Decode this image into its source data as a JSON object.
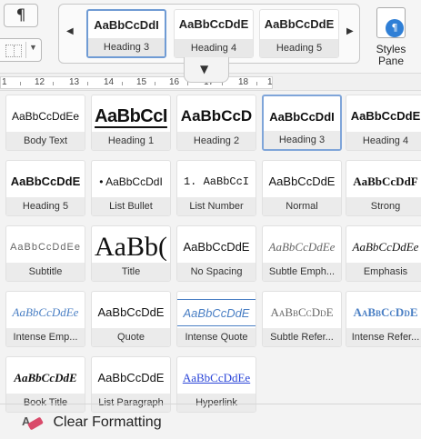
{
  "ribbon": {
    "pilcrow": "¶",
    "gallery": [
      {
        "sample": "AaBbCcDdI",
        "label": "Heading 3",
        "selected": true
      },
      {
        "sample": "AaBbCcDdE",
        "label": "Heading 4",
        "selected": false
      },
      {
        "sample": "AaBbCcDdE",
        "label": "Heading 5",
        "selected": false
      }
    ],
    "gallery_prev": "◀",
    "gallery_next": "▶",
    "styles_pane_label": "Styles Pane",
    "styles_pane_icon": "¶"
  },
  "ruler": {
    "numbers": [
      "1",
      "12",
      "13",
      "14",
      "15",
      "16",
      "17",
      "18",
      "1"
    ],
    "tab_marker": "▼"
  },
  "styles": [
    {
      "sample": "AaBbCcDdEe",
      "label": "Body Text",
      "cls": "st-bodytext"
    },
    {
      "sample": "AaBbCcI",
      "label": "Heading 1",
      "cls": "st-h1"
    },
    {
      "sample": "AaBbCcD",
      "label": "Heading 2",
      "cls": "st-h2"
    },
    {
      "sample": "AaBbCcDdI",
      "label": "Heading 3",
      "cls": "st-h3",
      "selected": true
    },
    {
      "sample": "AaBbCcDdE",
      "label": "Heading 4",
      "cls": "st-h4"
    },
    {
      "sample": "AaBbCcDdE",
      "label": "Heading 5",
      "cls": "st-h5"
    },
    {
      "sample": "• AaBbCcDdI",
      "label": "List Bullet",
      "cls": "st-listbullet"
    },
    {
      "sample": "1. AaBbCcI",
      "label": "List Number",
      "cls": "st-listnum"
    },
    {
      "sample": "AaBbCcDdE",
      "label": "Normal",
      "cls": "st-normal"
    },
    {
      "sample": "AaBbCcDdF",
      "label": "Strong",
      "cls": "st-strong"
    },
    {
      "sample": "AaBbCcDdEe",
      "label": "Subtitle",
      "cls": "st-subtitle"
    },
    {
      "sample": "AaBb(",
      "label": "Title",
      "cls": "st-title"
    },
    {
      "sample": "AaBbCcDdE",
      "label": "No Spacing",
      "cls": "st-nospacing"
    },
    {
      "sample": "AaBbCcDdEe",
      "label": "Subtle Emph...",
      "cls": "st-subtleemph"
    },
    {
      "sample": "AaBbCcDdEe",
      "label": "Emphasis",
      "cls": "st-emphasis"
    },
    {
      "sample": "AaBbCcDdEe",
      "label": "Intense Emp...",
      "cls": "st-intenseemp"
    },
    {
      "sample": "AaBbCcDdE",
      "label": "Quote",
      "cls": "st-quote"
    },
    {
      "sample": "AaBbCcDdE",
      "label": "Intense Quote",
      "cls": "st-intensequote"
    },
    {
      "sample": "AaBbCcDdE",
      "label": "Subtle Refer...",
      "cls": "st-subtleref"
    },
    {
      "sample": "AaBbCcDdE",
      "label": "Intense Refer...",
      "cls": "st-intenseref"
    },
    {
      "sample": "AaBbCcDdE",
      "label": "Book Title",
      "cls": "st-booktitle"
    },
    {
      "sample": "AaBbCcDdE",
      "label": "List Paragraph",
      "cls": "st-listpara"
    },
    {
      "sample": "AaBbCcDdEe",
      "label": "Hyperlink",
      "cls": "st-hyperlink"
    }
  ],
  "clear_formatting": {
    "label": "Clear Formatting",
    "icon": "eraser-icon",
    "icon_letter": "A"
  },
  "colors": {
    "accent": "#4a7fc4",
    "selection": "#7fa5d9",
    "hyperlink": "#2a45d8"
  }
}
